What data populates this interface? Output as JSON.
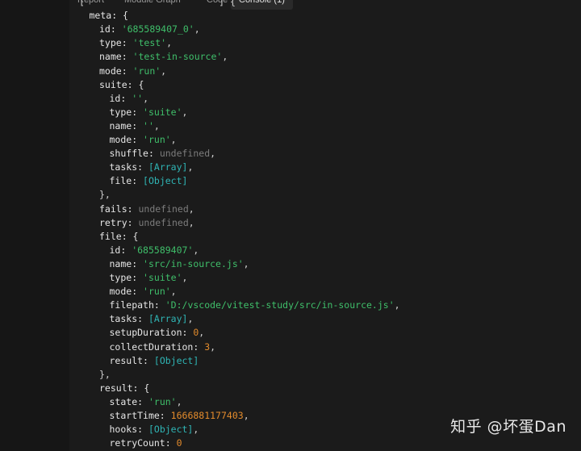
{
  "tabs": [
    "Report",
    "Module Graph",
    "Code",
    "Console (1)"
  ],
  "active_tab": "Console (1)",
  "console_lines": [
    {
      "indent": 0,
      "parts": [
        {
          "text": "[",
          "c": "p"
        },
        {
          "text": "                        ",
          "c": "p"
        },
        {
          "text": "] {",
          "c": "p"
        }
      ]
    },
    {
      "indent": 1,
      "parts": [
        {
          "text": "meta: {",
          "c": "k"
        }
      ]
    },
    {
      "indent": 2,
      "parts": [
        {
          "text": "id: ",
          "c": "k"
        },
        {
          "text": "'685589407_0'",
          "c": "s"
        },
        {
          "text": ",",
          "c": "p"
        }
      ]
    },
    {
      "indent": 2,
      "parts": [
        {
          "text": "type: ",
          "c": "k"
        },
        {
          "text": "'test'",
          "c": "s"
        },
        {
          "text": ",",
          "c": "p"
        }
      ]
    },
    {
      "indent": 2,
      "parts": [
        {
          "text": "name: ",
          "c": "k"
        },
        {
          "text": "'test-in-source'",
          "c": "s"
        },
        {
          "text": ",",
          "c": "p"
        }
      ]
    },
    {
      "indent": 2,
      "parts": [
        {
          "text": "mode: ",
          "c": "k"
        },
        {
          "text": "'run'",
          "c": "s"
        },
        {
          "text": ",",
          "c": "p"
        }
      ]
    },
    {
      "indent": 2,
      "parts": [
        {
          "text": "suite: {",
          "c": "k"
        }
      ]
    },
    {
      "indent": 3,
      "parts": [
        {
          "text": "id: ",
          "c": "k"
        },
        {
          "text": "''",
          "c": "s"
        },
        {
          "text": ",",
          "c": "p"
        }
      ]
    },
    {
      "indent": 3,
      "parts": [
        {
          "text": "type: ",
          "c": "k"
        },
        {
          "text": "'suite'",
          "c": "s"
        },
        {
          "text": ",",
          "c": "p"
        }
      ]
    },
    {
      "indent": 3,
      "parts": [
        {
          "text": "name: ",
          "c": "k"
        },
        {
          "text": "''",
          "c": "s"
        },
        {
          "text": ",",
          "c": "p"
        }
      ]
    },
    {
      "indent": 3,
      "parts": [
        {
          "text": "mode: ",
          "c": "k"
        },
        {
          "text": "'run'",
          "c": "s"
        },
        {
          "text": ",",
          "c": "p"
        }
      ]
    },
    {
      "indent": 3,
      "parts": [
        {
          "text": "shuffle: ",
          "c": "k"
        },
        {
          "text": "undefined",
          "c": "u"
        },
        {
          "text": ",",
          "c": "p"
        }
      ]
    },
    {
      "indent": 3,
      "parts": [
        {
          "text": "tasks: ",
          "c": "k"
        },
        {
          "text": "[Array]",
          "c": "t"
        },
        {
          "text": ",",
          "c": "p"
        }
      ]
    },
    {
      "indent": 3,
      "parts": [
        {
          "text": "file: ",
          "c": "k"
        },
        {
          "text": "[Object]",
          "c": "t"
        }
      ]
    },
    {
      "indent": 2,
      "parts": [
        {
          "text": "},",
          "c": "p"
        }
      ]
    },
    {
      "indent": 2,
      "parts": [
        {
          "text": "fails: ",
          "c": "k"
        },
        {
          "text": "undefined",
          "c": "u"
        },
        {
          "text": ",",
          "c": "p"
        }
      ]
    },
    {
      "indent": 2,
      "parts": [
        {
          "text": "retry: ",
          "c": "k"
        },
        {
          "text": "undefined",
          "c": "u"
        },
        {
          "text": ",",
          "c": "p"
        }
      ]
    },
    {
      "indent": 2,
      "parts": [
        {
          "text": "file: {",
          "c": "k"
        }
      ]
    },
    {
      "indent": 3,
      "parts": [
        {
          "text": "id: ",
          "c": "k"
        },
        {
          "text": "'685589407'",
          "c": "s"
        },
        {
          "text": ",",
          "c": "p"
        }
      ]
    },
    {
      "indent": 3,
      "parts": [
        {
          "text": "name: ",
          "c": "k"
        },
        {
          "text": "'src/in-source.js'",
          "c": "s"
        },
        {
          "text": ",",
          "c": "p"
        }
      ]
    },
    {
      "indent": 3,
      "parts": [
        {
          "text": "type: ",
          "c": "k"
        },
        {
          "text": "'suite'",
          "c": "s"
        },
        {
          "text": ",",
          "c": "p"
        }
      ]
    },
    {
      "indent": 3,
      "parts": [
        {
          "text": "mode: ",
          "c": "k"
        },
        {
          "text": "'run'",
          "c": "s"
        },
        {
          "text": ",",
          "c": "p"
        }
      ]
    },
    {
      "indent": 3,
      "parts": [
        {
          "text": "filepath: ",
          "c": "k"
        },
        {
          "text": "'D:/vscode/vitest-study/src/in-source.js'",
          "c": "s"
        },
        {
          "text": ",",
          "c": "p"
        }
      ]
    },
    {
      "indent": 3,
      "parts": [
        {
          "text": "tasks: ",
          "c": "k"
        },
        {
          "text": "[Array]",
          "c": "t"
        },
        {
          "text": ",",
          "c": "p"
        }
      ]
    },
    {
      "indent": 3,
      "parts": [
        {
          "text": "setupDuration: ",
          "c": "k"
        },
        {
          "text": "0",
          "c": "n"
        },
        {
          "text": ",",
          "c": "p"
        }
      ]
    },
    {
      "indent": 3,
      "parts": [
        {
          "text": "collectDuration: ",
          "c": "k"
        },
        {
          "text": "3",
          "c": "n"
        },
        {
          "text": ",",
          "c": "p"
        }
      ]
    },
    {
      "indent": 3,
      "parts": [
        {
          "text": "result: ",
          "c": "k"
        },
        {
          "text": "[Object]",
          "c": "t"
        }
      ]
    },
    {
      "indent": 2,
      "parts": [
        {
          "text": "},",
          "c": "p"
        }
      ]
    },
    {
      "indent": 2,
      "parts": [
        {
          "text": "result: {",
          "c": "k"
        }
      ]
    },
    {
      "indent": 3,
      "parts": [
        {
          "text": "state: ",
          "c": "k"
        },
        {
          "text": "'run'",
          "c": "s"
        },
        {
          "text": ",",
          "c": "p"
        }
      ]
    },
    {
      "indent": 3,
      "parts": [
        {
          "text": "startTime: ",
          "c": "k"
        },
        {
          "text": "1666881177403",
          "c": "n"
        },
        {
          "text": ",",
          "c": "p"
        }
      ]
    },
    {
      "indent": 3,
      "parts": [
        {
          "text": "hooks: ",
          "c": "k"
        },
        {
          "text": "[Object]",
          "c": "t"
        },
        {
          "text": ",",
          "c": "p"
        }
      ]
    },
    {
      "indent": 3,
      "parts": [
        {
          "text": "retryCount: ",
          "c": "k"
        },
        {
          "text": "0",
          "c": "n"
        }
      ]
    }
  ],
  "watermark": "知乎 @坏蛋Dan",
  "colors": {
    "string": "#3fbf6a",
    "undefined": "#7c7c7c",
    "number": "#e38b2c",
    "type": "#2fb5b5",
    "key": "#e6e6e6",
    "background": "#1b1b1b"
  }
}
